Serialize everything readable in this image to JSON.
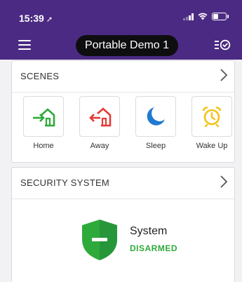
{
  "status_bar": {
    "time": "15:39"
  },
  "header": {
    "title": "Portable Demo 1",
    "accent": "#4b2a83"
  },
  "scenes": {
    "title": "SCENES",
    "items": [
      {
        "label": "Home",
        "icon": "home-enter-icon",
        "color": "#2eaa3b"
      },
      {
        "label": "Away",
        "icon": "home-leave-icon",
        "color": "#e53935"
      },
      {
        "label": "Sleep",
        "icon": "moon-icon",
        "color": "#1f7ad1"
      },
      {
        "label": "Wake Up",
        "icon": "alarm-clock-icon",
        "color": "#f3c316"
      }
    ]
  },
  "security": {
    "title": "SECURITY SYSTEM",
    "system_name": "System",
    "status": "DISARMED",
    "status_color": "#2eaa3b"
  }
}
